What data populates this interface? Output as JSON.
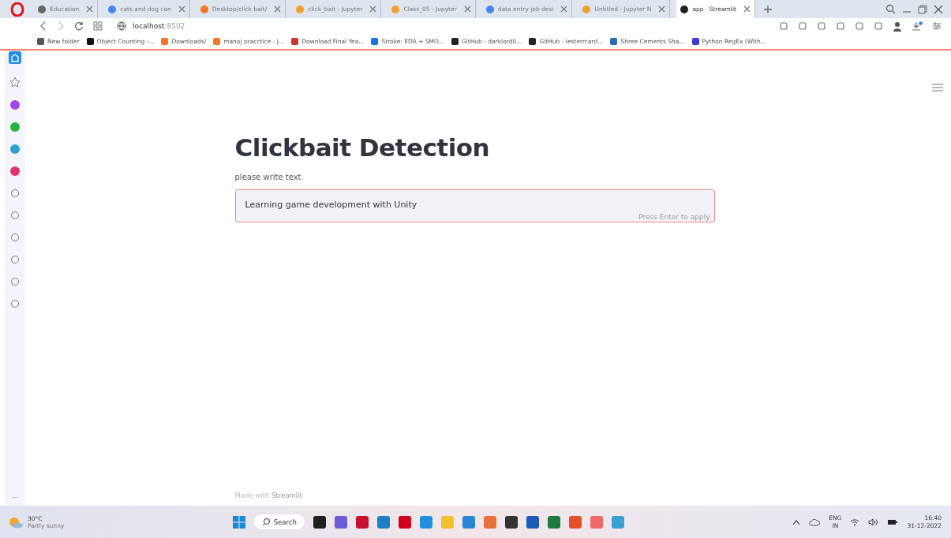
{
  "browser": {
    "tabs": [
      {
        "label": "Education",
        "selected": false
      },
      {
        "label": "cats and dog con",
        "selected": false
      },
      {
        "label": "Desktop/click bait/",
        "selected": false
      },
      {
        "label": "click_bait - Jupyter",
        "selected": false
      },
      {
        "label": "Class_05 - Jupyter",
        "selected": false
      },
      {
        "label": "data entry job desi",
        "selected": false
      },
      {
        "label": "Untitled - Jupyter N",
        "selected": false
      },
      {
        "label": "app · Streamlit",
        "selected": true
      }
    ],
    "address": {
      "host": "localhost",
      "port": ":8502"
    },
    "bookmarks": [
      {
        "label": "New folder"
      },
      {
        "label": "Object Counting -..."
      },
      {
        "label": "Downloads/"
      },
      {
        "label": "manoj pracctice - J..."
      },
      {
        "label": "Download Final Yea..."
      },
      {
        "label": "Stroke: EDA + SMO..."
      },
      {
        "label": "GitHub - darklord0..."
      },
      {
        "label": "GitHub - lesterrcard..."
      },
      {
        "label": "Shree Cements Sha..."
      },
      {
        "label": "Python RegEx (With..."
      }
    ],
    "sidebar_more": "..."
  },
  "app": {
    "title": "Clickbait Detection",
    "input": {
      "label": "please write text",
      "value": "Learning game development with Unity",
      "hint": "Press Enter to apply"
    },
    "footer": {
      "prefix": "Made with",
      "brand": "Streamlit"
    }
  },
  "taskbar": {
    "weather": {
      "temperature": "30°C",
      "condition": "Partly sunny"
    },
    "search": "Search",
    "language": {
      "code": "ENG",
      "region": "IN"
    },
    "time": "16:40",
    "date": "31-12-2022"
  }
}
